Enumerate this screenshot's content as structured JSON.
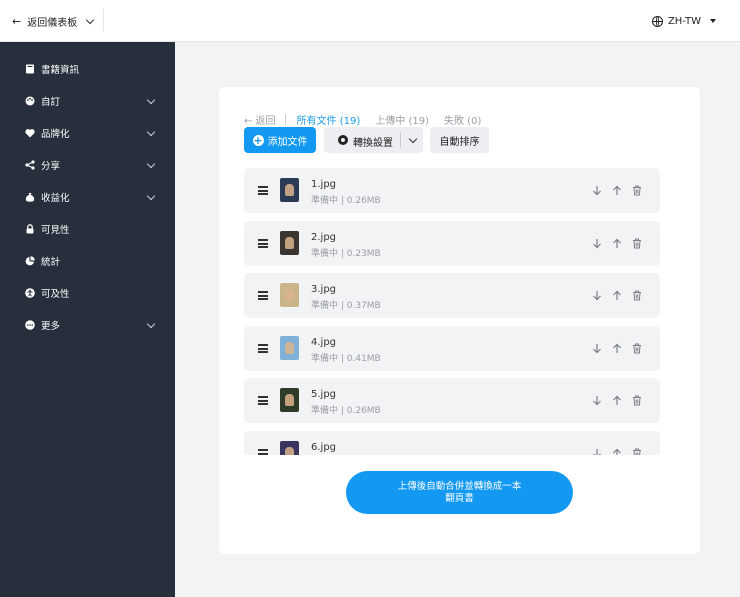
{
  "topbar": {
    "back_label": "返回儀表板",
    "language": "ZH-TW"
  },
  "sidebar": {
    "items": [
      {
        "label": "書籍資訊",
        "icon": "book-icon",
        "expandable": false
      },
      {
        "label": "自訂",
        "icon": "palette-icon",
        "expandable": true
      },
      {
        "label": "品牌化",
        "icon": "tag-icon",
        "expandable": true
      },
      {
        "label": "分享",
        "icon": "share-icon",
        "expandable": true
      },
      {
        "label": "收益化",
        "icon": "money-bag-icon",
        "expandable": true
      },
      {
        "label": "可見性",
        "icon": "lock-icon",
        "expandable": false
      },
      {
        "label": "統計",
        "icon": "pie-chart-icon",
        "expandable": false
      },
      {
        "label": "可及性",
        "icon": "accessibility-icon",
        "expandable": false
      },
      {
        "label": "更多",
        "icon": "more-icon",
        "expandable": true
      }
    ]
  },
  "tabs": {
    "back": "← 返回",
    "all": "所有文件 (19)",
    "uploading": "上傳中 (19)",
    "failed": "失敗 (0)"
  },
  "toolbar": {
    "add_label": "添加文件",
    "convert_label": "轉換設置",
    "sort_label": "自動排序"
  },
  "files": [
    {
      "name": "1.jpg",
      "meta": "準備中 | 0.26MB",
      "thumb_color": "#2b3a55"
    },
    {
      "name": "2.jpg",
      "meta": "準備中 | 0.23MB",
      "thumb_color": "#3a3530"
    },
    {
      "name": "3.jpg",
      "meta": "準備中 | 0.37MB",
      "thumb_color": "#c9b58a"
    },
    {
      "name": "4.jpg",
      "meta": "準備中 | 0.41MB",
      "thumb_color": "#7fb0d8"
    },
    {
      "name": "5.jpg",
      "meta": "準備中 | 0.26MB",
      "thumb_color": "#2e3b28"
    },
    {
      "name": "6.jpg",
      "meta": "",
      "thumb_color": "#3a3560"
    }
  ],
  "upload_button": {
    "line1": "上傳後自動合併並轉換成一本",
    "line2": "翻頁書"
  },
  "colors": {
    "accent": "#1499f2",
    "sidebar_bg": "#262f3b"
  }
}
